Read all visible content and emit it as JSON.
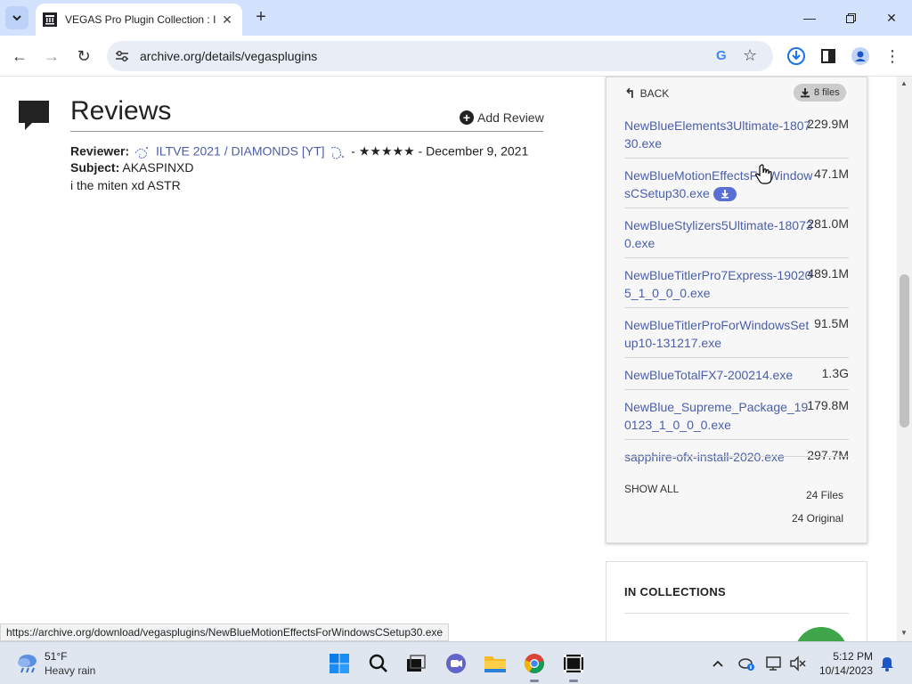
{
  "browser": {
    "tab_title": "VEGAS Pro Plugin Collection : I",
    "url": "archive.org/details/vegasplugins",
    "status_url": "https://archive.org/download/vegasplugins/NewBlueMotionEffectsForWindowsCSetup30.exe"
  },
  "reviews": {
    "heading": "Reviews",
    "add_review": "Add Review",
    "reviewer_label": "Reviewer:",
    "reviewer_name": "ILTVE 2021 / DIAMONDS [YT]",
    "separator": " - ",
    "stars": "★★★★★",
    "date": "December 9, 2021",
    "subject_label": "Subject:",
    "subject": "AKASPINXD",
    "body": "i the miten xd ASTR"
  },
  "files_panel": {
    "back": "BACK",
    "files_badge": "8 files",
    "files": [
      {
        "name": "NewBlueElements3Ultimate-180730.exe",
        "size": "229.9M"
      },
      {
        "name": "NewBlueMotionEffectsForWindowsCSetup30.exe",
        "size": "47.1M"
      },
      {
        "name": "NewBlueStylizers5Ultimate-180730.exe",
        "size": "281.0M"
      },
      {
        "name": "NewBlueTitlerPro7Express-190205_1_0_0_0.exe",
        "size": "489.1M"
      },
      {
        "name": "NewBlueTitlerProForWindowsSetup10-131217.exe",
        "size": "91.5M"
      },
      {
        "name": "NewBlueTotalFX7-200214.exe",
        "size": "1.3G"
      },
      {
        "name": "NewBlue_Supreme_Package_190123_1_0_0_0.exe",
        "size": "179.8M"
      },
      {
        "name": "sapphire-ofx-install-2020.exe",
        "size": "297.7M"
      }
    ],
    "show_all": "SHOW ALL",
    "files_count": "24 Files",
    "original_count": "24 Original"
  },
  "collections": {
    "title": "IN COLLECTIONS"
  },
  "taskbar": {
    "temperature": "51°F",
    "weather": "Heavy rain",
    "time": "5:12 PM",
    "date": "10/14/2023"
  }
}
